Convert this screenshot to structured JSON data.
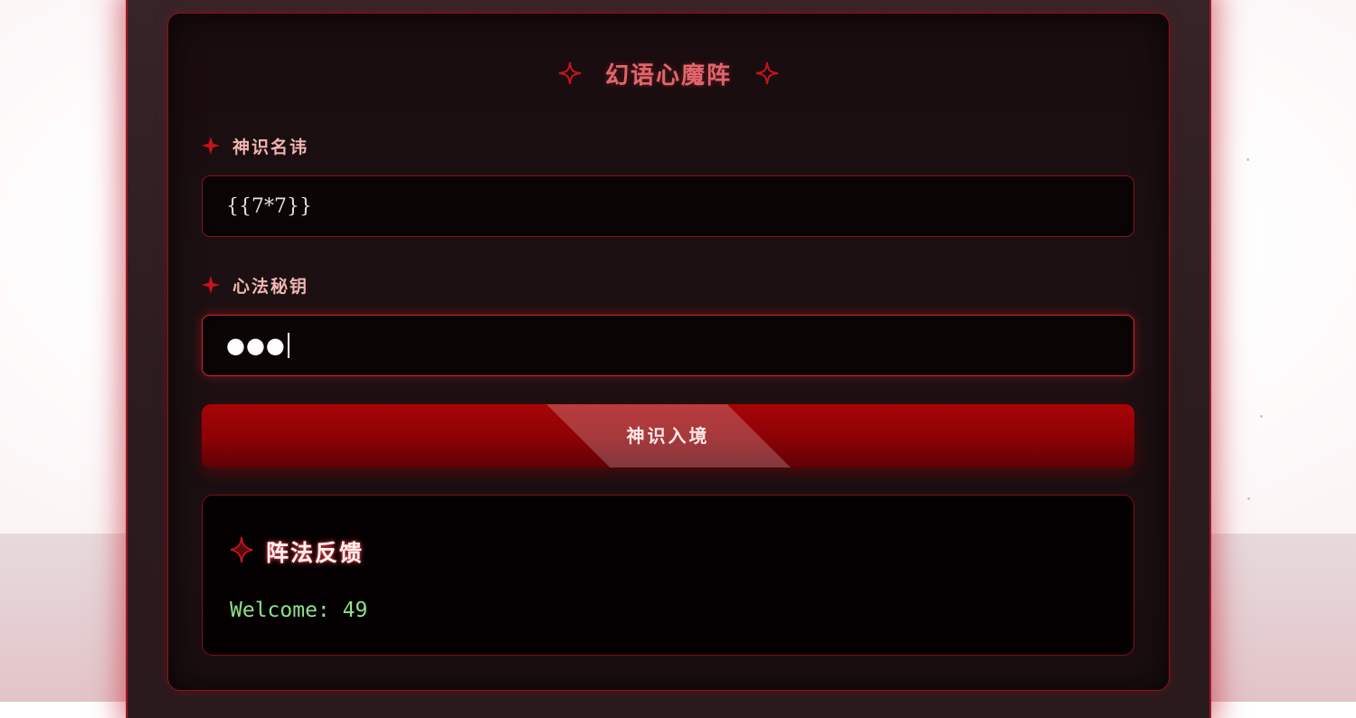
{
  "theme": {
    "accent": "#d6222c",
    "button_red": "#a80407",
    "title_pink": "#e0666c",
    "label_pink": "#efb5b0",
    "success_green": "#8ee08a"
  },
  "header": {
    "title": "幻语心魔阵",
    "left_icon": "four-point-star-icon",
    "right_icon": "four-point-star-icon"
  },
  "form": {
    "username": {
      "label": "神识名讳",
      "icon": "sparkle-icon",
      "value": "{{7*7}}"
    },
    "password": {
      "label": "心法秘钥",
      "icon": "sparkle-icon",
      "masked_value": "●●●",
      "focused": true
    },
    "submit_label": "神识入境"
  },
  "result": {
    "icon": "diamond-star-icon",
    "title": "阵法反馈",
    "message": "Welcome: 49"
  }
}
